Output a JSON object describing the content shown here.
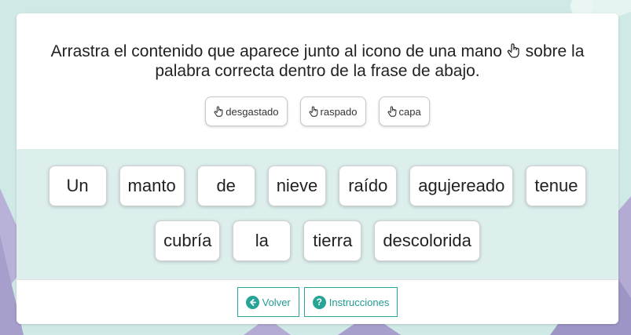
{
  "instructions": {
    "line1": "Arrastra el contenido que aparece junto al icono de una mano",
    "line1_end": "sobre la",
    "line2": "palabra correcta dentro de la frase de abajo.",
    "hand_icon": "pointing-hand-icon"
  },
  "draggables": [
    {
      "label": "desgastado"
    },
    {
      "label": "raspado"
    },
    {
      "label": "capa"
    }
  ],
  "sentence": {
    "row1": [
      "Un",
      "manto",
      "de",
      "nieve",
      "raído",
      "agujereado",
      "tenue"
    ],
    "row2": [
      "cubría",
      "la",
      "tierra",
      "descolorida"
    ]
  },
  "footer": {
    "back_label": "Volver",
    "back_icon": "arrow-left-circle-icon",
    "help_label": "Instrucciones",
    "help_icon": "question-circle-icon"
  },
  "colors": {
    "accent": "#26a596",
    "background": "#cfe9e6",
    "mountains": "#b3abd3"
  }
}
